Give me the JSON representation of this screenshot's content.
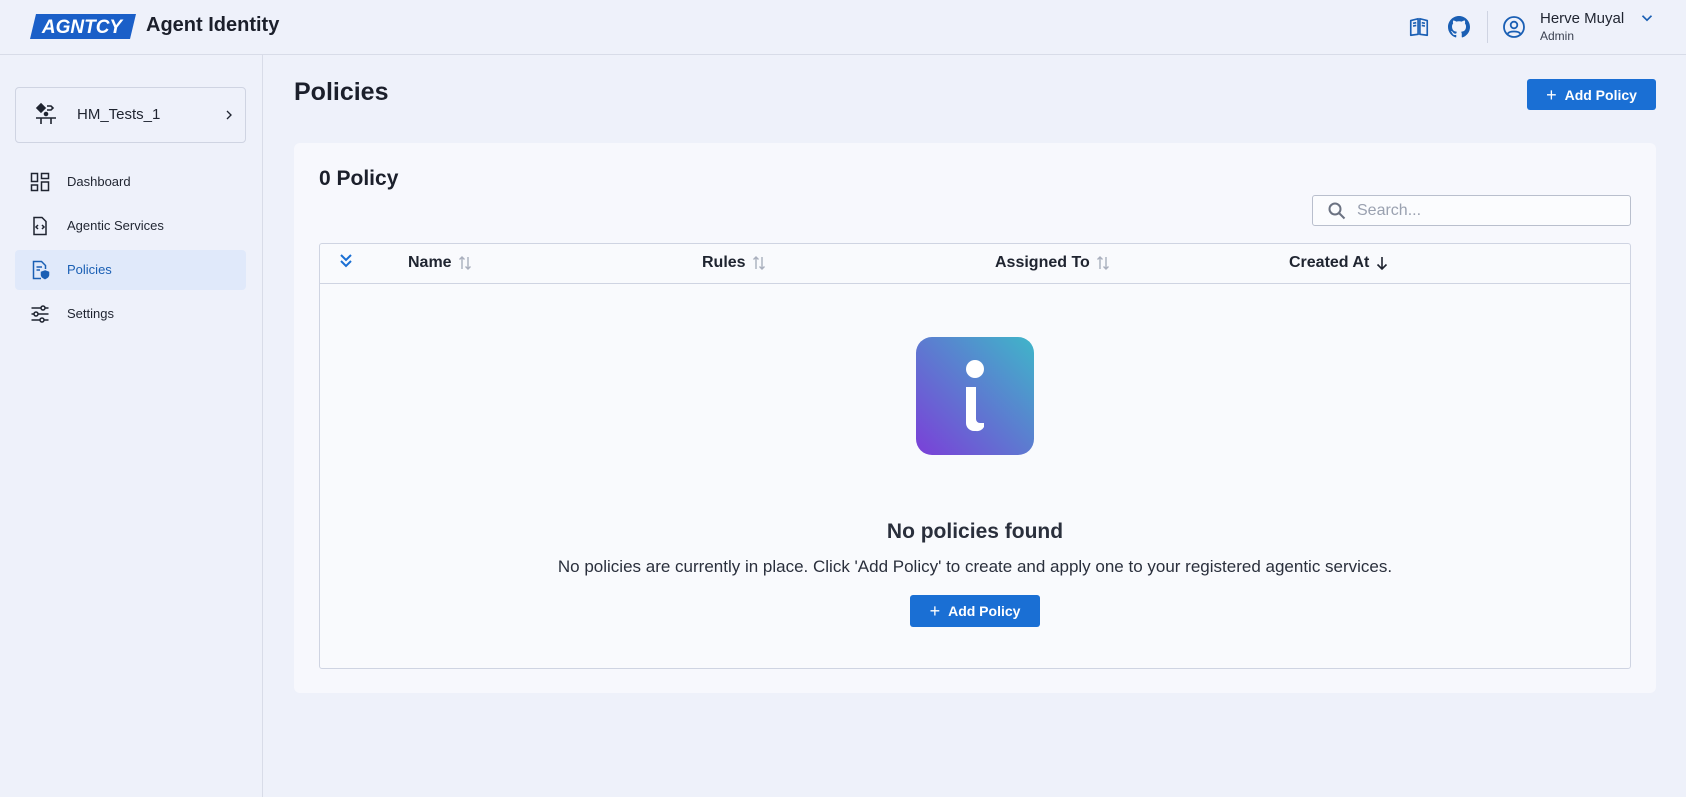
{
  "header": {
    "logo_text": "AGNTCY",
    "app_title": "Agent Identity",
    "icons": [
      "book-icon",
      "github-icon",
      "user-circle-icon",
      "chevron-down-icon"
    ],
    "user": {
      "name": "Herve Muyal",
      "role": "Admin"
    }
  },
  "sidebar": {
    "org": {
      "name": "HM_Tests_1",
      "icon": "org-icon"
    },
    "items": [
      {
        "label": "Dashboard",
        "icon": "dashboard-icon",
        "active": false
      },
      {
        "label": "Agentic Services",
        "icon": "code-file-icon",
        "active": false
      },
      {
        "label": "Policies",
        "icon": "policy-icon",
        "active": true
      },
      {
        "label": "Settings",
        "icon": "sliders-icon",
        "active": false
      }
    ]
  },
  "main": {
    "title": "Policies",
    "add_button_label": "Add Policy",
    "count_label": "0 Policy",
    "search": {
      "placeholder": "Search...",
      "value": ""
    },
    "table": {
      "columns": [
        {
          "label": "Name",
          "sort": "none"
        },
        {
          "label": "Rules",
          "sort": "none"
        },
        {
          "label": "Assigned To",
          "sort": "none"
        },
        {
          "label": "Created At",
          "sort": "desc"
        }
      ],
      "rows": []
    },
    "empty_state": {
      "title": "No policies found",
      "description": "No policies are currently in place. Click 'Add Policy' to create and apply one to your registered agentic services.",
      "button_label": "Add Policy"
    }
  },
  "colors": {
    "accent": "#1a6fd4",
    "active_nav_bg": "#e0e9fa",
    "background": "#eef1fa",
    "gradient_start": "#7b3fd8",
    "gradient_end": "#3fb6c9"
  }
}
